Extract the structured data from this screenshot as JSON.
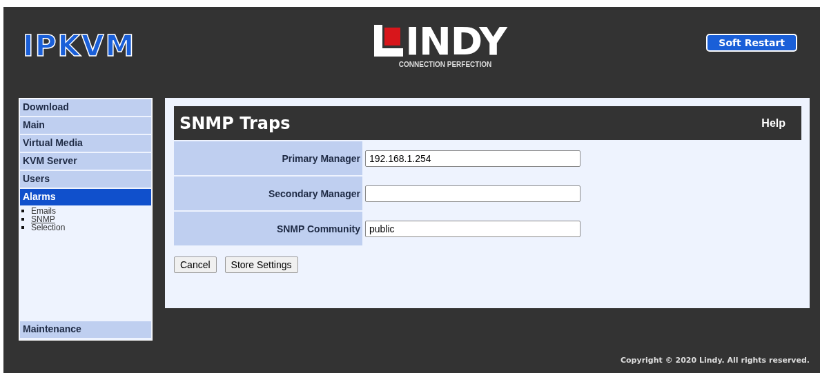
{
  "header": {
    "product": "IPKVM",
    "brand": "INDY",
    "tagline": "CONNECTION PERFECTION",
    "restart_button": "Soft Restart"
  },
  "sidebar": {
    "items": [
      {
        "label": "Download",
        "selected": false
      },
      {
        "label": "Main",
        "selected": false
      },
      {
        "label": "Virtual Media",
        "selected": false
      },
      {
        "label": "KVM Server",
        "selected": false
      },
      {
        "label": "Users",
        "selected": false
      },
      {
        "label": "Alarms",
        "selected": true,
        "children": [
          {
            "label": "Emails",
            "selected": false
          },
          {
            "label": "SNMP",
            "selected": true
          },
          {
            "label": "Selection",
            "selected": false
          }
        ]
      }
    ],
    "bottom_item": {
      "label": "Maintenance",
      "selected": false
    }
  },
  "panel": {
    "title": "SNMP Traps",
    "help": "Help",
    "fields": [
      {
        "label": "Primary Manager",
        "value": "192.168.1.254"
      },
      {
        "label": "Secondary Manager"
      },
      {
        "label": "SNMP Community",
        "value": "public"
      }
    ],
    "buttons": [
      "Cancel",
      "Store Settings"
    ]
  },
  "footer": "Copyright © 2020 Lindy. All rights reserved."
}
